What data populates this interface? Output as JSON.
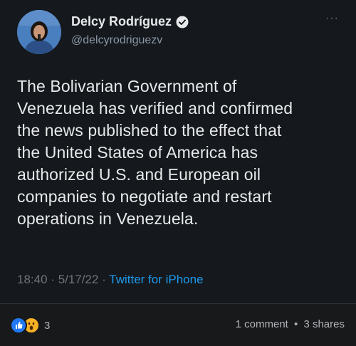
{
  "tweet": {
    "display_name": "Delcy Rodríguez",
    "handle": "@delcyrodriguezv",
    "text": "The Bolivarian Government of\nVenezuela has verified and confirmed\nthe news published to the effect that\nthe United States of America has\nauthorized U.S. and European oil\ncompanies to negotiate and restart\noperations in Venezuela.",
    "time": "18:40",
    "date": "5/17/22",
    "separator": "·",
    "source": "Twitter for iPhone",
    "verified_icon": "verified-badge-icon",
    "more_icon": "more-dots-icon"
  },
  "facebook_bar": {
    "reaction_icons": [
      "like-reaction-icon",
      "wow-reaction-icon"
    ],
    "reaction_count": "3",
    "comments": "1 comment",
    "stats_separator": "•",
    "shares": "3 shares"
  },
  "colors": {
    "background": "#15181c",
    "text": "#e7e9ea",
    "secondary": "#8b98a5",
    "link": "#1d9bf0",
    "fb_bar": "#18191a"
  }
}
